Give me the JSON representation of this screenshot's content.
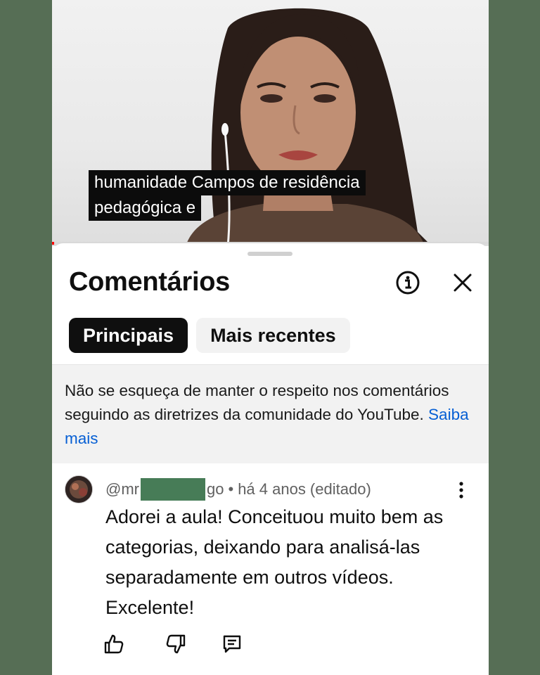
{
  "video": {
    "caption_line1": "humanidade Campos de residência",
    "caption_line2": "pedagógica e",
    "progress_fraction": 0.003
  },
  "comments_panel": {
    "title": "Comentários",
    "info_icon": "info-icon",
    "close_icon": "close-icon",
    "tabs": [
      {
        "label": "Principais",
        "selected": true
      },
      {
        "label": "Mais recentes",
        "selected": false
      }
    ],
    "notice": {
      "text": "Não se esqueça de manter o respeito nos comentários seguindo as diretrizes da comunidade do YouTube.",
      "link": "Saiba mais"
    },
    "comments": [
      {
        "handle_start": "@mr",
        "handle_end": "go",
        "separator": "•",
        "time": "há 4 anos (editado)",
        "text": "Adorei a aula! Conceituou muito bem as categorias, deixando para analisá-las separadamente em outros vídeos. Excelente!",
        "actions": [
          "like-icon",
          "dislike-icon",
          "reply-icon"
        ],
        "menu_icon": "more-vert-icon"
      }
    ]
  },
  "colors": {
    "background": "#566e55",
    "link": "#065fd4",
    "progress": "#ff0000",
    "redaction": "#477c57"
  }
}
